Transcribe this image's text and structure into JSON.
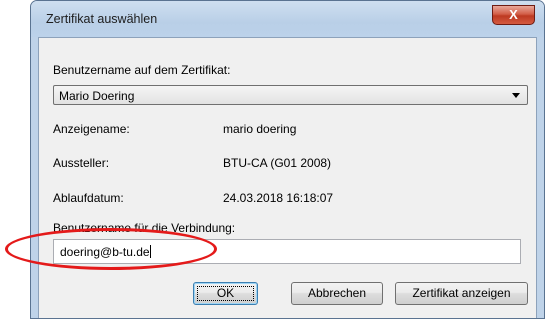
{
  "window": {
    "title": "Zertifikat auswählen",
    "close_label": "X"
  },
  "form": {
    "cert_user_label": "Benutzername auf dem Zertifikat:",
    "cert_user_value": "Mario Doering",
    "display_name_label": "Anzeigename:",
    "display_name_value": "mario doering",
    "issuer_label": "Aussteller:",
    "issuer_value": "BTU-CA (G01 2008)",
    "expiry_label": "Ablaufdatum:",
    "expiry_value": "24.03.2018 16:18:07",
    "conn_user_label": "Benutzername für die Verbindung:",
    "conn_user_value": "doering@b-tu.de"
  },
  "buttons": {
    "ok": "OK",
    "cancel": "Abbrechen",
    "show_cert": "Zertifikat anzeigen"
  },
  "colors": {
    "annotation": "#e41a1a",
    "frame": "#bfd3e9"
  }
}
